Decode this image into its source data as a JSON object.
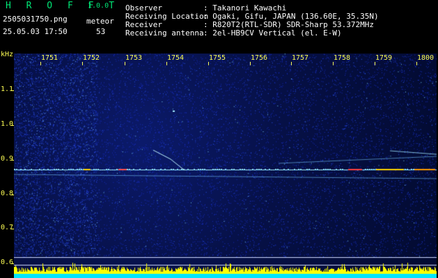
{
  "app": {
    "name": "H R O F F T",
    "version": "1.0.0"
  },
  "file": {
    "name": "2505031750.png",
    "datetime": "25.05.03 17:50"
  },
  "meteor": {
    "label": "meteor",
    "count": "53"
  },
  "info": [
    {
      "label": "Observer",
      "value": ": Takanori Kawachi"
    },
    {
      "label": "Receiving Location",
      "value": ": Ogaki, Gifu, JAPAN (136.60E, 35.35N)"
    },
    {
      "label": "Receiver",
      "value": ": R820T2(RTL-SDR) SDR-Sharp 53.372MHz"
    },
    {
      "label": "Receiving antenna",
      "value": ": 2el-HB9CV Vertical (el. E-W)"
    }
  ],
  "axis": {
    "y_unit": "kHz",
    "x_ticks": [
      "1751",
      "1752",
      "1753",
      "1754",
      "1755",
      "1756",
      "1757",
      "1758",
      "1759",
      "1800"
    ],
    "y_ticks": [
      "1.1",
      "1.0",
      "0.9",
      "0.8",
      "0.7",
      "0.6"
    ]
  },
  "colors": {
    "text": "#ffffff",
    "brand": "#00e676",
    "axis": "#ffff55",
    "noise": "#1a2fbf",
    "baseline": "#00e5ff",
    "bursts": "#ffff00"
  }
}
